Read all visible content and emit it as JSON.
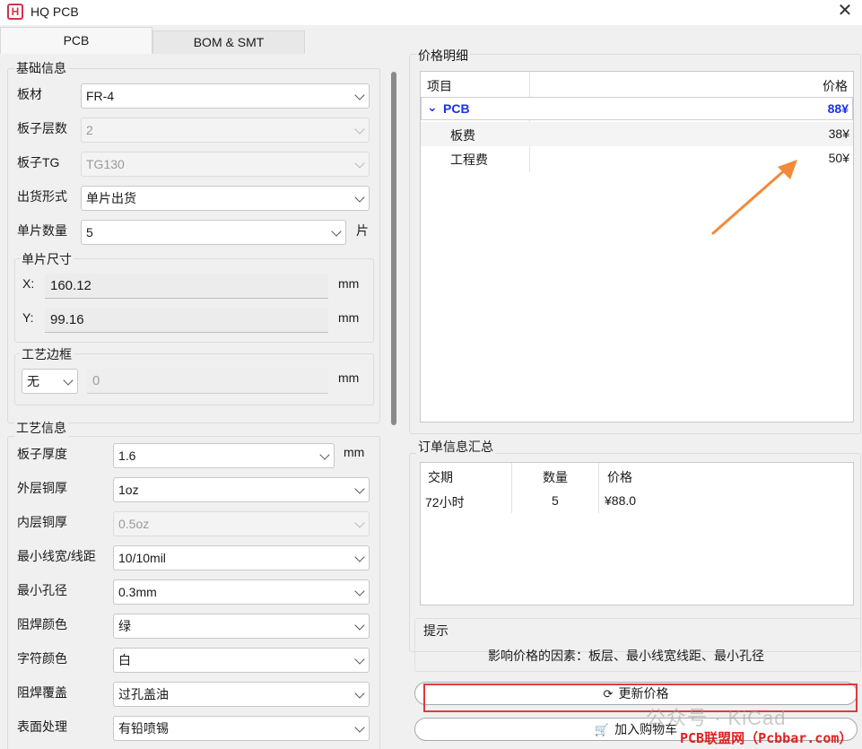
{
  "window": {
    "title": "HQ PCB",
    "logo_letter": "H",
    "close_glyph": "✕"
  },
  "tabs": [
    {
      "label": "PCB",
      "active": true
    },
    {
      "label": "BOM & SMT",
      "active": false
    }
  ],
  "basic_info": {
    "title": "基础信息",
    "board_material": {
      "label": "板材",
      "value": "FR-4"
    },
    "layers": {
      "label": "板子层数",
      "value": "2"
    },
    "tg": {
      "label": "板子TG",
      "value": "TG130"
    },
    "shipping": {
      "label": "出货形式",
      "value": "单片出货"
    },
    "quantity": {
      "label": "单片数量",
      "value": "5",
      "unit": "片"
    },
    "size": {
      "title": "单片尺寸",
      "x_label": "X:",
      "x_value": "160.12",
      "x_unit": "mm",
      "y_label": "Y:",
      "y_value": "99.16",
      "y_unit": "mm"
    },
    "frame": {
      "title": "工艺边框",
      "type_value": "无",
      "width_value": "0",
      "unit": "mm"
    }
  },
  "process_info": {
    "title": "工艺信息",
    "thickness": {
      "label": "板子厚度",
      "value": "1.6",
      "unit": "mm"
    },
    "outer_copper": {
      "label": "外层铜厚",
      "value": "1oz"
    },
    "inner_copper": {
      "label": "内层铜厚",
      "value": "0.5oz"
    },
    "min_trace": {
      "label": "最小线宽/线距",
      "value": "10/10mil"
    },
    "min_hole": {
      "label": "最小孔径",
      "value": "0.3mm"
    },
    "mask_color": {
      "label": "阻焊颜色",
      "value": "绿"
    },
    "silk_color": {
      "label": "字符颜色",
      "value": "白"
    },
    "mask_cover": {
      "label": "阻焊覆盖",
      "value": "过孔盖油"
    },
    "surface": {
      "label": "表面处理",
      "value": "有铅喷锡"
    }
  },
  "price_detail": {
    "title": "价格明细",
    "headers": {
      "item": "项目",
      "price": "价格"
    },
    "pcb": {
      "name": "PCB",
      "price": "88¥",
      "expander": "⌄"
    },
    "children": [
      {
        "name": "板费",
        "price": "38¥"
      },
      {
        "name": "工程费",
        "price": "50¥"
      }
    ]
  },
  "order_summary": {
    "title": "订单信息汇总",
    "headers": {
      "delivery": "交期",
      "qty": "数量",
      "price": "价格"
    },
    "row": {
      "delivery": "72小时",
      "qty": "5",
      "price": "¥88.0"
    }
  },
  "hint": {
    "title": "提示",
    "text": "影响价格的因素：板层、最小线宽线距、最小孔径"
  },
  "buttons": {
    "update_price": {
      "label": "更新价格",
      "icon": "⟳"
    },
    "add_cart": {
      "label": "加入购物车",
      "icon": "🛒"
    }
  },
  "watermarks": {
    "wechat": "公众号 · KiCad",
    "site": "PCB联盟网（Pcbbar.com）"
  },
  "colors": {
    "accent_blue": "#1a33e6",
    "arrow_orange": "#f28a3a",
    "highlight_red": "#e03a3a"
  }
}
